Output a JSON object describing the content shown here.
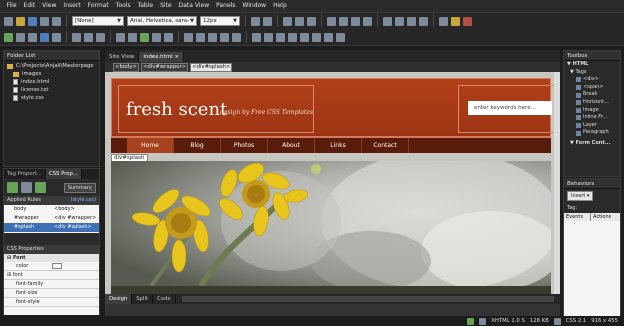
{
  "menu": [
    "File",
    "Edit",
    "View",
    "Insert",
    "Format",
    "Tools",
    "Table",
    "Site",
    "Data View",
    "Panels",
    "Window",
    "Help"
  ],
  "toolbar": {
    "style_select": "[None]",
    "font_select": "Arial, Helvetica, sans-seri",
    "size_select": "12px"
  },
  "folder_list": {
    "title": "Folder List",
    "path": "C:\\Projects\\Anjali\\Masterpage",
    "items": [
      "images",
      "index.html",
      "license.txt",
      "style.css"
    ]
  },
  "tag_panel": {
    "tabs": [
      "Tag Propert...",
      "CSS Prop..."
    ],
    "summary_button": "Summary",
    "applied_rules_label": "Applied Rules",
    "applied_rules_link": "(style.css)",
    "rules": [
      {
        "selector": "body",
        "tag": "<body>"
      },
      {
        "selector": "#wrapper",
        "tag": "<div #wrapper>"
      },
      {
        "selector": "#splash",
        "tag": "<div #splash>"
      }
    ],
    "css_properties_label": "CSS Properties",
    "font_group": "Font",
    "props": [
      "color",
      "font",
      "font-family",
      "font-size",
      "font-style"
    ]
  },
  "document": {
    "tabs": [
      "Site View",
      "index.html"
    ],
    "tag_selector": [
      "<body>",
      "<div#wrapper>",
      "<div#splash>"
    ],
    "site": {
      "logo": "fresh scent",
      "tagline": "design by Free CSS Templates",
      "search_placeholder": "enter keywords here...",
      "nav": [
        "Home",
        "Blog",
        "Photos",
        "About",
        "Links",
        "Contact"
      ],
      "div_label": "div#splash"
    },
    "view_buttons": [
      "Design",
      "Split",
      "Code"
    ]
  },
  "toolbox": {
    "title": "Toolbox",
    "group": "HTML",
    "subgroup": "Tags",
    "items": [
      "<div>",
      "<span>",
      "Break",
      "Horizont...",
      "Image",
      "Inline Fr...",
      "Layer",
      "Paragraph"
    ],
    "form_group": "Form Cont..."
  },
  "behaviors": {
    "title": "Behaviors",
    "insert_label": "Insert",
    "tag_label": "Tag:",
    "col_events": "Events",
    "col_actions": "Actions"
  },
  "status": {
    "doctype": "XHTML 1.0 S",
    "size": "128 KB",
    "css": "CSS 2.1",
    "dims": "916 x 455"
  },
  "colors": {
    "header": "#a8391a",
    "nav": "#5a1c0a",
    "accent": "#d27a5a"
  }
}
